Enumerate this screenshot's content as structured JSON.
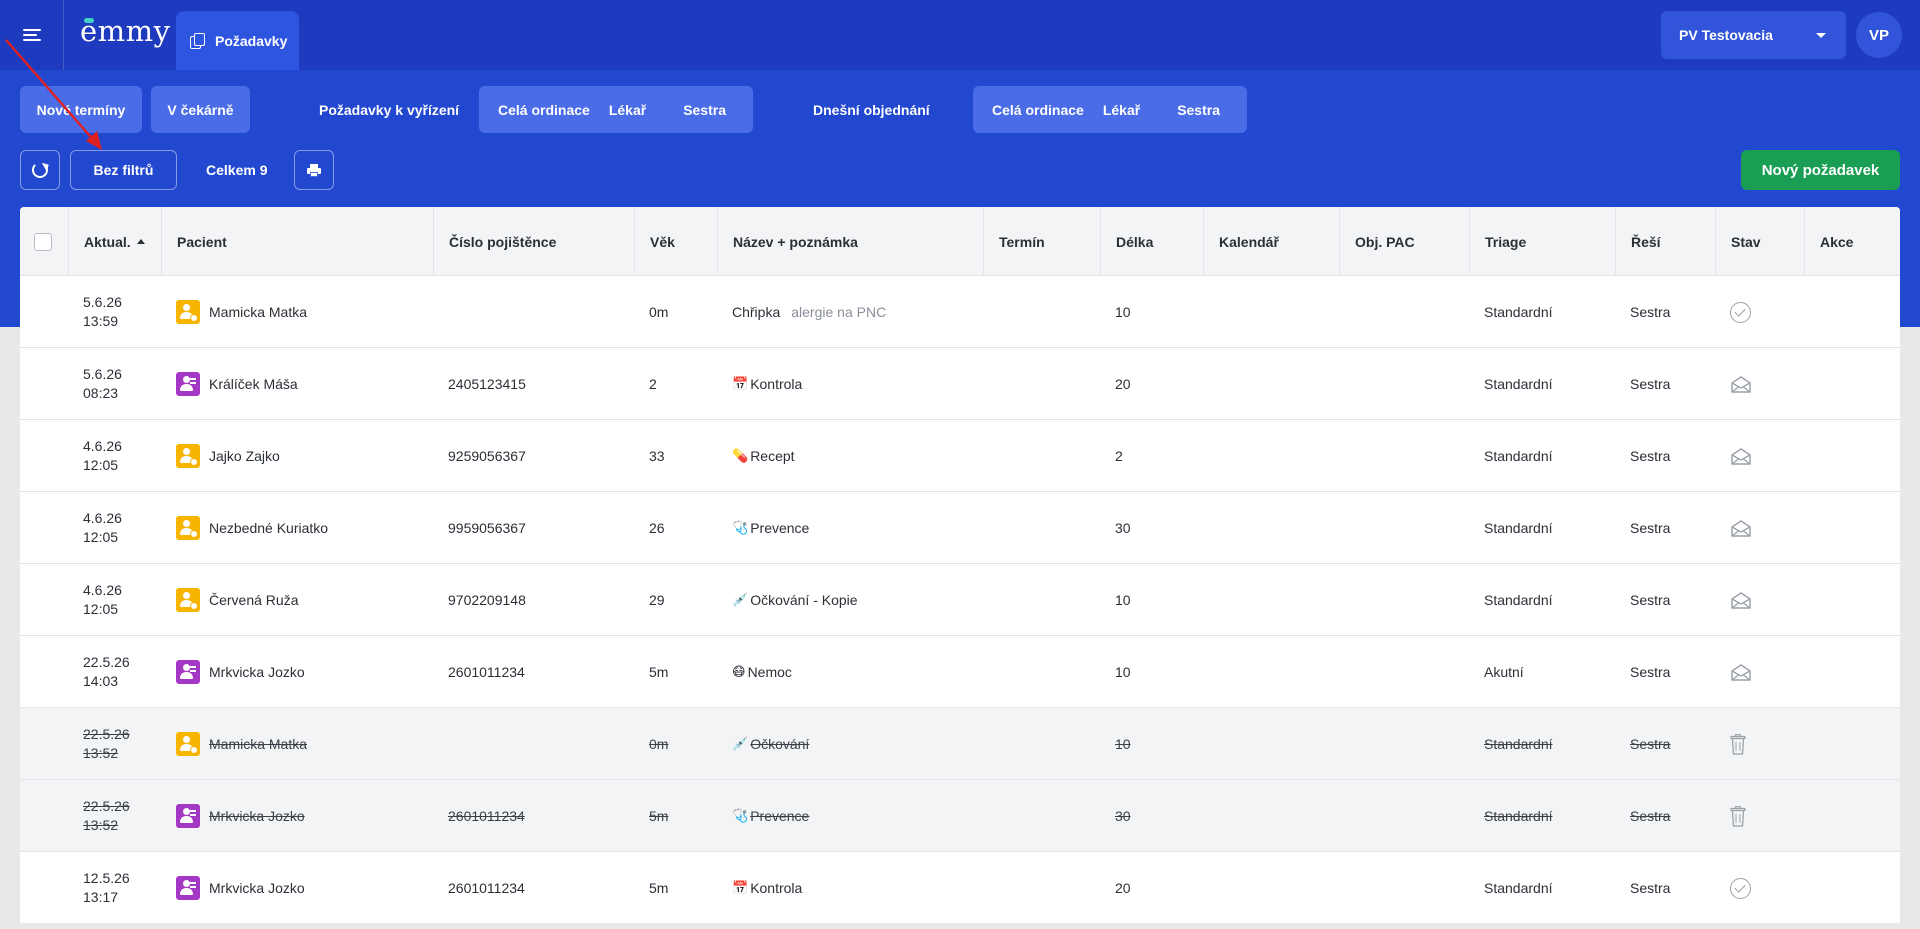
{
  "app": {
    "logo": "emmy",
    "active_tab": "Požadavky",
    "org_select": "PV Testovacia",
    "avatar": "VP"
  },
  "toolbar": {
    "new_terms": "Nové termíny",
    "waiting_room": "V čekárně",
    "requests_label": "Požadavky k vyřízení",
    "requests_group": [
      "Celá ordinace",
      "Lékař",
      "Sestra"
    ],
    "today_label": "Dnešní objednání",
    "today_group": [
      "Celá ordinace",
      "Lékař",
      "Sestra"
    ],
    "filter": "Bez filtrů",
    "total": "Celkem 9",
    "new_request": "Nový požadavek"
  },
  "table": {
    "columns": [
      "Aktual.",
      "Pacient",
      "Číslo pojištěnce",
      "Věk",
      "Název + poznámka",
      "Termín",
      "Délka",
      "Kalendář",
      "Obj. PAC",
      "Triage",
      "Řeší",
      "Stav",
      "Akce"
    ],
    "rows": [
      {
        "date": "5.6.26",
        "time": "13:59",
        "patient": "Mamicka Matka",
        "patient_type": "yellow",
        "insurance": "",
        "age": "0m",
        "emoji": "",
        "name": "Chřipka",
        "note": "alergie na PNC",
        "term": "",
        "length": "10",
        "triage": "Standardní",
        "resolver": "Sestra",
        "status": "check",
        "struck": false
      },
      {
        "date": "5.6.26",
        "time": "08:23",
        "patient": "Králíček Máša",
        "patient_type": "purple",
        "insurance": "2405123415",
        "age": "2",
        "emoji": "📅",
        "name": "Kontrola",
        "note": "",
        "term": "",
        "length": "20",
        "triage": "Standardní",
        "resolver": "Sestra",
        "status": "mail",
        "struck": false
      },
      {
        "date": "4.6.26",
        "time": "12:05",
        "patient": "Jajko Zajko",
        "patient_type": "yellow",
        "insurance": "9259056367",
        "age": "33",
        "emoji": "💊",
        "name": "Recept",
        "note": "",
        "term": "",
        "length": "2",
        "triage": "Standardní",
        "resolver": "Sestra",
        "status": "mail",
        "struck": false
      },
      {
        "date": "4.6.26",
        "time": "12:05",
        "patient": "Nezbedné Kuriatko",
        "patient_type": "yellow",
        "insurance": "9959056367",
        "age": "26",
        "emoji": "🩺",
        "name": "Prevence",
        "note": "",
        "term": "",
        "length": "30",
        "triage": "Standardní",
        "resolver": "Sestra",
        "status": "mail",
        "struck": false
      },
      {
        "date": "4.6.26",
        "time": "12:05",
        "patient": "Červená Ruža",
        "patient_type": "yellow",
        "insurance": "9702209148",
        "age": "29",
        "emoji": "💉",
        "name": "Očkování - Kopie",
        "note": "",
        "term": "",
        "length": "10",
        "triage": "Standardní",
        "resolver": "Sestra",
        "status": "mail",
        "struck": false
      },
      {
        "date": "22.5.26",
        "time": "14:03",
        "patient": "Mrkvicka Jozko",
        "patient_type": "purple",
        "insurance": "2601011234",
        "age": "5m",
        "emoji": "😷",
        "name": "Nemoc",
        "note": "",
        "term": "",
        "length": "10",
        "triage": "Akutní",
        "resolver": "Sestra",
        "status": "mail",
        "struck": false
      },
      {
        "date": "22.5.26",
        "time": "13:52",
        "patient": "Mamicka Matka",
        "patient_type": "yellow",
        "insurance": "",
        "age": "0m",
        "emoji": "💉",
        "name": "Očkování",
        "note": "",
        "term": "",
        "length": "10",
        "triage": "Standardní",
        "resolver": "Sestra",
        "status": "trash",
        "struck": true
      },
      {
        "date": "22.5.26",
        "time": "13:52",
        "patient": "Mrkvicka Jozko",
        "patient_type": "purple",
        "insurance": "2601011234",
        "age": "5m",
        "emoji": "🩺",
        "name": "Prevence",
        "note": "",
        "term": "",
        "length": "30",
        "triage": "Standardní",
        "resolver": "Sestra",
        "status": "trash",
        "struck": true
      },
      {
        "date": "12.5.26",
        "time": "13:17",
        "patient": "Mrkvicka Jozko",
        "patient_type": "purple",
        "insurance": "2601011234",
        "age": "5m",
        "emoji": "📅",
        "name": "Kontrola",
        "note": "",
        "term": "",
        "length": "20",
        "triage": "Standardní",
        "resolver": "Sestra",
        "status": "check",
        "struck": false
      }
    ]
  },
  "colors": {
    "header": "#1e3abf",
    "toolbar": "#2348d0",
    "button": "#4a6ce6",
    "green": "#1a9e54",
    "yellow_patient": "#f7b500",
    "purple_patient": "#a338c4",
    "arrow": "#e02020"
  }
}
